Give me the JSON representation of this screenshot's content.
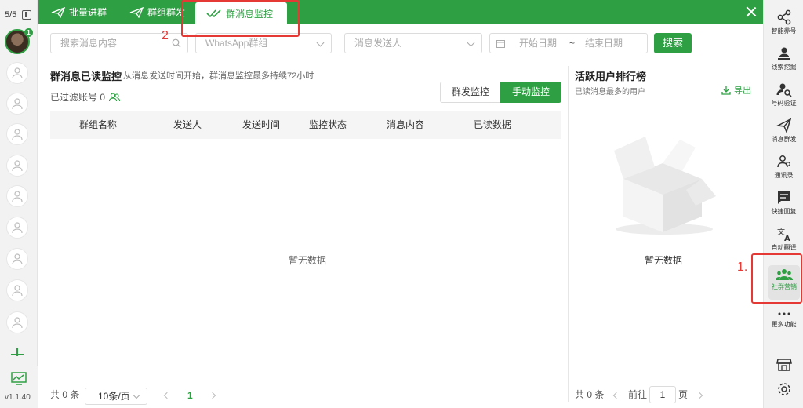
{
  "left_sidebar": {
    "account_count": "5/5",
    "badge": "1",
    "version": "v1.1.40"
  },
  "tabs": [
    {
      "label": "批量进群"
    },
    {
      "label": "群组群发"
    },
    {
      "label": "群消息监控"
    }
  ],
  "filters": {
    "search_placeholder": "搜索消息内容",
    "group_select": "WhatsApp群组",
    "sender_select": "消息发送人",
    "start_date": "开始日期",
    "date_sep": "~",
    "end_date": "结束日期",
    "search_button": "搜索"
  },
  "main": {
    "title": "群消息已读监控",
    "description": "从消息发送时间开始，群消息监控最多持续72小时",
    "filtered_label": "已过滤账号 0",
    "seg_group": "群发监控",
    "seg_manual": "手动监控",
    "columns": [
      "群组名称",
      "发送人",
      "发送时间",
      "监控状态",
      "消息内容",
      "已读数据"
    ],
    "empty_text": "暂无数据",
    "total": "共 0 条",
    "page_size": "10条/页",
    "current_page": "1"
  },
  "ranking": {
    "title": "活跃用户排行榜",
    "subtitle": "已读消息最多的用户",
    "export": "导出",
    "empty_text": "暂无数据",
    "total": "共 0 条",
    "goto_label": "前往",
    "goto_page": "1",
    "page_suffix": "页"
  },
  "right_rail": [
    {
      "label": "智能养号",
      "icon": "share-icon"
    },
    {
      "label": "线索挖掘",
      "icon": "person-pin-icon"
    },
    {
      "label": "号码验证",
      "icon": "person-search-icon"
    },
    {
      "label": "消息群发",
      "icon": "send-icon"
    },
    {
      "label": "通讯录",
      "icon": "contacts-icon"
    },
    {
      "label": "快捷回复",
      "icon": "chat-icon"
    },
    {
      "label": "自动翻译",
      "icon": "translate-icon"
    },
    {
      "label": "社群营销",
      "icon": "group-icon"
    },
    {
      "label": "更多功能",
      "icon": "more-icon"
    }
  ],
  "annotations": {
    "one": "1.",
    "two": "2"
  },
  "colors": {
    "accent": "#2ea043",
    "annotation": "#e53935"
  }
}
